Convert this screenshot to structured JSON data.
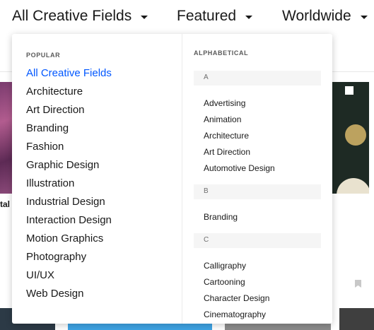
{
  "filters": [
    {
      "label": "All Creative Fields"
    },
    {
      "label": "Featured"
    },
    {
      "label": "Worldwide"
    }
  ],
  "background": {
    "card_title_fragment": "tal"
  },
  "dropdown": {
    "popular_heading": "POPULAR",
    "popular_items": [
      {
        "label": "All Creative Fields",
        "active": true
      },
      {
        "label": "Architecture"
      },
      {
        "label": "Art Direction"
      },
      {
        "label": "Branding"
      },
      {
        "label": "Fashion"
      },
      {
        "label": "Graphic Design"
      },
      {
        "label": "Illustration"
      },
      {
        "label": "Industrial Design"
      },
      {
        "label": "Interaction Design"
      },
      {
        "label": "Motion Graphics"
      },
      {
        "label": "Photography"
      },
      {
        "label": "UI/UX"
      },
      {
        "label": "Web Design"
      }
    ],
    "alphabetical_heading": "ALPHABETICAL",
    "groups": [
      {
        "letter": "A",
        "items": [
          "Advertising",
          "Animation",
          "Architecture",
          "Art Direction",
          "Automotive Design"
        ]
      },
      {
        "letter": "B",
        "items": [
          "Branding"
        ]
      },
      {
        "letter": "C",
        "items": [
          "Calligraphy",
          "Cartooning",
          "Character Design",
          "Cinematography"
        ]
      }
    ]
  },
  "colors": {
    "active_link": "#0057ff",
    "text": "#191919"
  }
}
